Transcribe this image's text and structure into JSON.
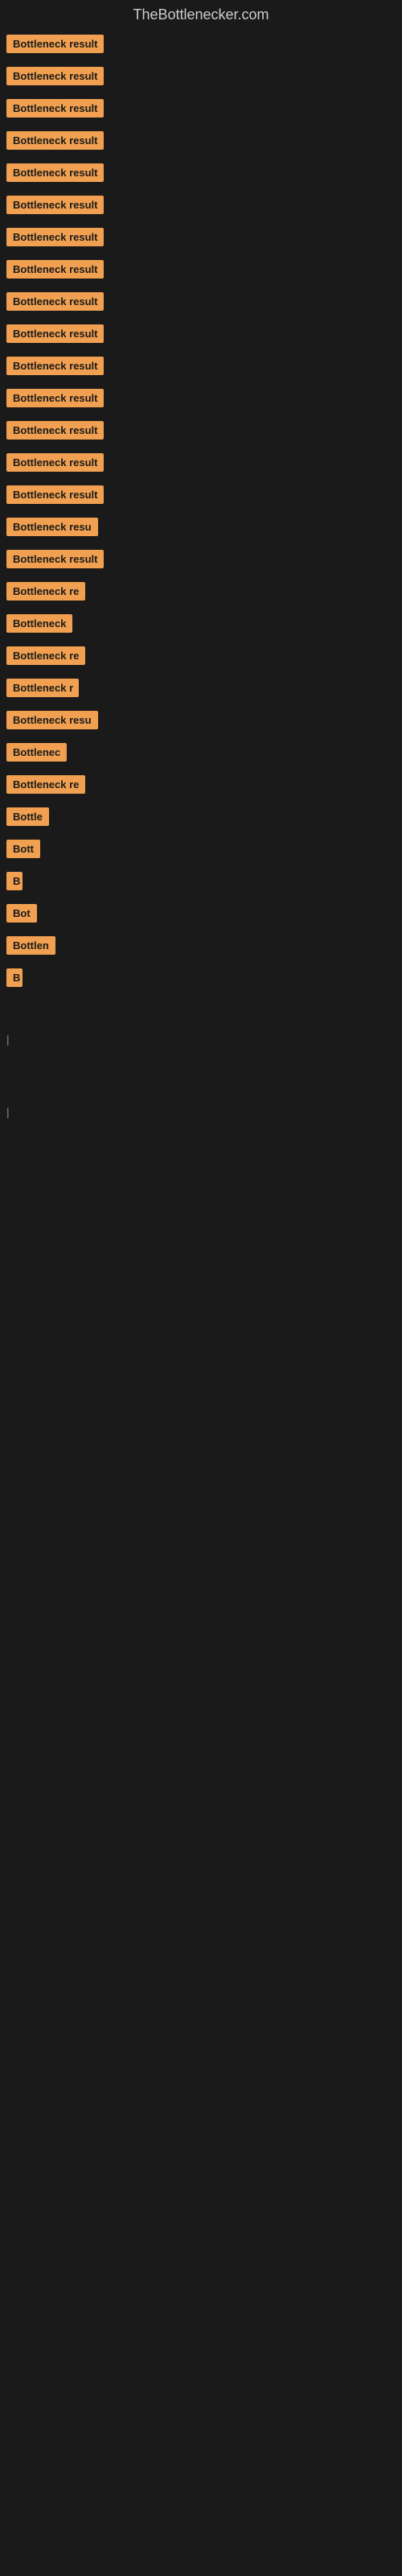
{
  "site": {
    "title": "TheBottlenecker.com"
  },
  "items": [
    {
      "label": "Bottleneck result",
      "width": 130
    },
    {
      "label": "Bottleneck result",
      "width": 130
    },
    {
      "label": "Bottleneck result",
      "width": 130
    },
    {
      "label": "Bottleneck result",
      "width": 130
    },
    {
      "label": "Bottleneck result",
      "width": 130
    },
    {
      "label": "Bottleneck result",
      "width": 130
    },
    {
      "label": "Bottleneck result",
      "width": 130
    },
    {
      "label": "Bottleneck result",
      "width": 130
    },
    {
      "label": "Bottleneck result",
      "width": 130
    },
    {
      "label": "Bottleneck result",
      "width": 130
    },
    {
      "label": "Bottleneck result",
      "width": 130
    },
    {
      "label": "Bottleneck result",
      "width": 130
    },
    {
      "label": "Bottleneck result",
      "width": 130
    },
    {
      "label": "Bottleneck result",
      "width": 130
    },
    {
      "label": "Bottleneck result",
      "width": 130
    },
    {
      "label": "Bottleneck resu",
      "width": 115
    },
    {
      "label": "Bottleneck result",
      "width": 130
    },
    {
      "label": "Bottleneck re",
      "width": 100
    },
    {
      "label": "Bottleneck",
      "width": 85
    },
    {
      "label": "Bottleneck re",
      "width": 100
    },
    {
      "label": "Bottleneck r",
      "width": 90
    },
    {
      "label": "Bottleneck resu",
      "width": 115
    },
    {
      "label": "Bottlenec",
      "width": 80
    },
    {
      "label": "Bottleneck re",
      "width": 100
    },
    {
      "label": "Bottle",
      "width": 60
    },
    {
      "label": "Bott",
      "width": 50
    },
    {
      "label": "B",
      "width": 20
    },
    {
      "label": "Bot",
      "width": 40
    },
    {
      "label": "Bottlen",
      "width": 65
    },
    {
      "label": "B",
      "width": 20
    },
    {
      "label": "",
      "width": 0
    },
    {
      "label": "",
      "width": 0
    },
    {
      "label": "|",
      "width": 10
    },
    {
      "label": "",
      "width": 0
    },
    {
      "label": "",
      "width": 0
    },
    {
      "label": "",
      "width": 0
    },
    {
      "label": "|",
      "width": 10
    }
  ]
}
